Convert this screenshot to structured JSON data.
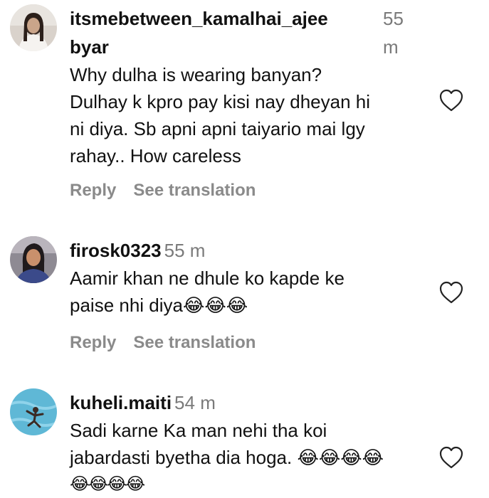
{
  "comments": [
    {
      "username": "itsmebetween_kamalhai_ajeebyar",
      "username_line1": "itsmebetween_kamalhai_ajee",
      "username_line2": "byar",
      "time_line1": "55",
      "time_line2": "m",
      "text_lines": [
        "Why dulha is wearing banyan?",
        "Dulhay k kpro pay kisi nay dheyan hi",
        "ni diya. Sb apni apni taiyario mai lgy",
        "rahay.. How careless"
      ],
      "reply_label": "Reply",
      "translate_label": "See translation",
      "avatar_icon": "user-avatar-woman-white-top",
      "like_icon": "heart-outline-icon"
    },
    {
      "username": "firosk0323",
      "time": "55 m",
      "text_lines": [
        "Aamir khan ne dhule ko kapde ke",
        "paise nhi diya😂😂😂"
      ],
      "reply_label": "Reply",
      "translate_label": "See translation",
      "avatar_icon": "user-avatar-woman-dark-hair",
      "like_icon": "heart-outline-icon"
    },
    {
      "username": "kuheli.maiti",
      "time": "54 m",
      "text_lines": [
        "Sadi karne Ka man nehi tha koi",
        "jabardasti byetha dia hoga. 😂😂😂😂",
        "😂😂😂😂"
      ],
      "avatar_icon": "user-avatar-swimming-pool",
      "like_icon": "heart-outline-icon"
    }
  ],
  "colors": {
    "username": "#111111",
    "timestamp": "#7a7a7a",
    "action": "#8a8a8a",
    "heart_stroke": "#222222"
  }
}
